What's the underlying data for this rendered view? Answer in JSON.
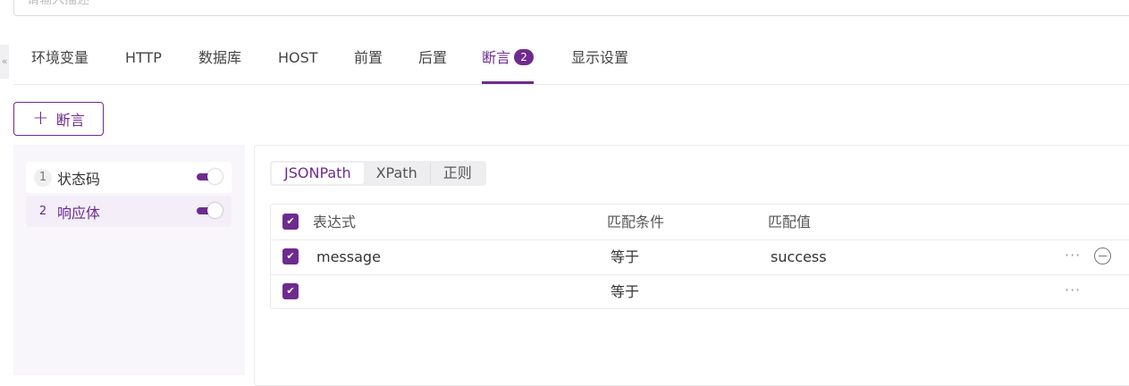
{
  "description": {
    "placeholder": "请输入描述"
  },
  "sidebar_toggle": {
    "glyph": "«"
  },
  "tabs": [
    {
      "label": "环境变量"
    },
    {
      "label": "HTTP"
    },
    {
      "label": "数据库"
    },
    {
      "label": "HOST"
    },
    {
      "label": "前置"
    },
    {
      "label": "后置"
    },
    {
      "label": "断言",
      "badge": "2",
      "active": true
    },
    {
      "label": "显示设置"
    }
  ],
  "add_button": {
    "icon": "plus-icon",
    "glyph": "+",
    "label": "断言"
  },
  "rules": [
    {
      "index": "1",
      "name": "状态码",
      "enabled": true
    },
    {
      "index": "2",
      "name": "响应体",
      "enabled": true,
      "selected": true
    }
  ],
  "modes": [
    {
      "label": "JSONPath",
      "active": true
    },
    {
      "label": "XPath"
    },
    {
      "label": "正则"
    }
  ],
  "table": {
    "headers": {
      "expression": "表达式",
      "condition": "匹配条件",
      "value": "匹配值"
    },
    "rows": [
      {
        "checked": true,
        "expression": "message",
        "condition": "等于",
        "value": "success",
        "more": "···"
      },
      {
        "checked": true,
        "expression": "",
        "condition": "等于",
        "value": "",
        "more": "···"
      }
    ]
  },
  "colors": {
    "accent": "#6e2b8f",
    "panel_bg": "#f8f6fb"
  }
}
